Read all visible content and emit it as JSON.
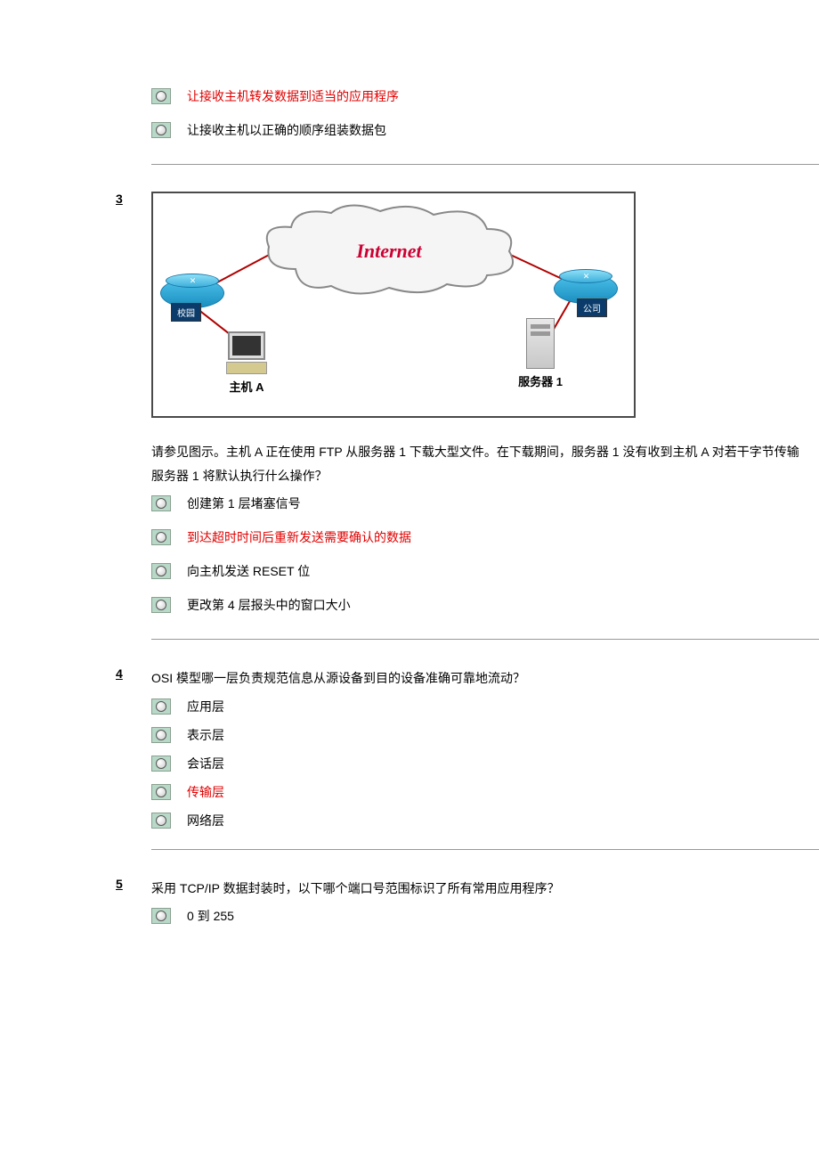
{
  "q2_tail": {
    "options": [
      {
        "text": "让接收主机转发数据到适当的应用程序",
        "correct": true
      },
      {
        "text": "让接收主机以正确的顺序组装数据包",
        "correct": false
      }
    ]
  },
  "q3": {
    "num": "3",
    "diagram": {
      "cloud_label": "Internet",
      "router_left_label": "校园",
      "router_right_label": "公司",
      "host_label": "主机 A",
      "server_label": "服务器 1"
    },
    "text_line1": "请参见图示。主机 A 正在使用 FTP 从服务器 1 下载大型文件。在下载期间，服务器 1 没有收到主机 A 对若干字节传输",
    "text_line2": "服务器 1 将默认执行什么操作？",
    "options": [
      {
        "text": "创建第 1 层堵塞信号",
        "correct": false
      },
      {
        "text": "到达超时时间后重新发送需要确认的数据",
        "correct": true
      },
      {
        "text": "向主机发送 RESET 位",
        "correct": false
      },
      {
        "text": "更改第 4 层报头中的窗口大小",
        "correct": false
      }
    ]
  },
  "q4": {
    "num": "4",
    "text": "OSI 模型哪一层负责规范信息从源设备到目的设备准确可靠地流动？",
    "options": [
      {
        "text": "应用层",
        "correct": false
      },
      {
        "text": "表示层",
        "correct": false
      },
      {
        "text": "会话层",
        "correct": false
      },
      {
        "text": "传输层",
        "correct": true
      },
      {
        "text": "网络层",
        "correct": false
      }
    ]
  },
  "q5": {
    "num": "5",
    "text": "采用 TCP/IP 数据封装时，以下哪个端口号范围标识了所有常用应用程序？",
    "options": [
      {
        "text": "0 到 255",
        "correct": false
      }
    ]
  }
}
